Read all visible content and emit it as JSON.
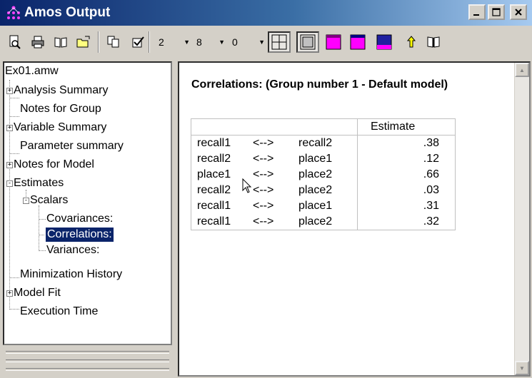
{
  "window": {
    "title": "Amos Output"
  },
  "toolbar": {
    "combo_values": [
      "2",
      "8",
      "0"
    ]
  },
  "tree": {
    "root": "Ex01.amw",
    "items": [
      {
        "label": "Analysis Summary",
        "expander": "+"
      },
      {
        "label": "Notes for Group",
        "expander": ""
      },
      {
        "label": "Variable Summary",
        "expander": "+"
      },
      {
        "label": "Parameter summary",
        "expander": ""
      },
      {
        "label": "Notes for Model",
        "expander": "+"
      },
      {
        "label": "Estimates",
        "expander": "-"
      },
      {
        "label": "Scalars",
        "expander": "-"
      },
      {
        "label": "Covariances:",
        "expander": ""
      },
      {
        "label": "Correlations:",
        "expander": "",
        "selected": true
      },
      {
        "label": "Variances:",
        "expander": ""
      },
      {
        "label": "Minimization History",
        "expander": ""
      },
      {
        "label": "Model Fit",
        "expander": "+"
      },
      {
        "label": "Execution Time",
        "expander": ""
      }
    ]
  },
  "content": {
    "heading": "Correlations: (Group number 1 - Default model)",
    "table": {
      "header": "Estimate",
      "rows": [
        {
          "left": "recall1",
          "arrow": "<-->",
          "right": "recall2",
          "estimate": ".38"
        },
        {
          "left": "recall2",
          "arrow": "<-->",
          "right": "place1",
          "estimate": ".12"
        },
        {
          "left": "place1",
          "arrow": "<-->",
          "right": "place2",
          "estimate": ".66"
        },
        {
          "left": "recall2",
          "arrow": "<-->",
          "right": "place2",
          "estimate": ".03"
        },
        {
          "left": "recall1",
          "arrow": "<-->",
          "right": "place1",
          "estimate": ".31"
        },
        {
          "left": "recall1",
          "arrow": "<-->",
          "right": "place2",
          "estimate": ".32"
        }
      ]
    }
  }
}
